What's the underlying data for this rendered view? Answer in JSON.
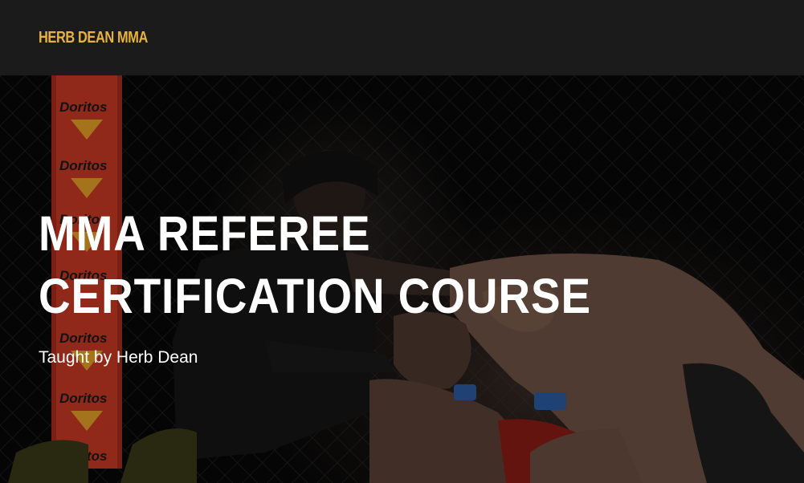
{
  "header": {
    "brand": "HERB DEAN MMA"
  },
  "hero": {
    "title": "MMA REFEREE CERTIFICATION COURSE",
    "subtitle": "Taught by Herb Dean",
    "banner_text": [
      "Doritos",
      "Doritos",
      "Doritos",
      "Doritos",
      "Doritos",
      "Doritos",
      "Doritos"
    ]
  },
  "colors": {
    "header_bg": "#1b1b1b",
    "brand": "#e8b33d",
    "banner_red": "#d9402b",
    "text": "#ffffff"
  }
}
